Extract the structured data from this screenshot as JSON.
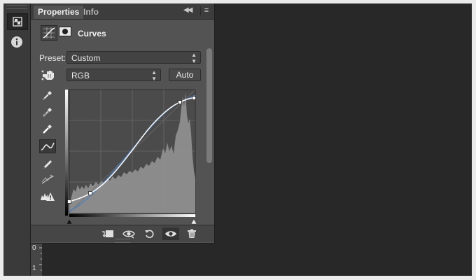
{
  "tabs": [
    {
      "label": "Properties",
      "active": true
    },
    {
      "label": "Info",
      "active": false
    }
  ],
  "header": {
    "title": "Curves"
  },
  "preset": {
    "label": "Preset:",
    "value": "Custom"
  },
  "channel": {
    "value": "RGB"
  },
  "auto_button": {
    "label": "Auto"
  },
  "ruler": {
    "marks": [
      "0",
      "1"
    ]
  },
  "icons": {
    "strip": [
      "adjustments-icon",
      "info-icon"
    ],
    "tools": [
      "black-point-eyedropper-icon",
      "gray-point-eyedropper-icon",
      "white-point-eyedropper-icon",
      "curve-points-icon",
      "pencil-icon",
      "smooth-icon",
      "clipping-warning-icon"
    ],
    "bottom": [
      "clip-to-layer-icon",
      "view-previous-icon",
      "reset-icon",
      "visibility-icon",
      "delete-icon"
    ]
  },
  "colors": {
    "panel_bg": "#535353",
    "curve_line": "#ffffff",
    "histogram": "#8e8e8e",
    "channel_curve": "#4a7fc4"
  }
}
